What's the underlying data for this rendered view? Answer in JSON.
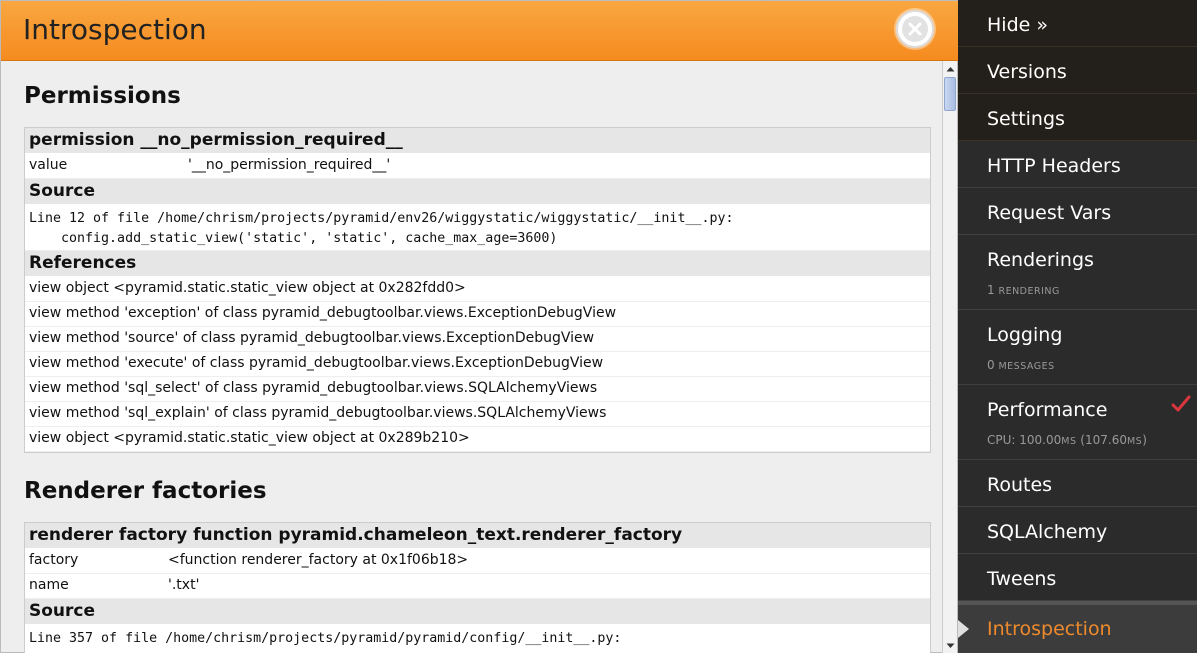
{
  "panel": {
    "title": "Introspection"
  },
  "permissions": {
    "heading": "Permissions",
    "header": "permission __no_permission_required__",
    "value_key": "value",
    "value_val": "'__no_permission_required__'",
    "source_label": "Source",
    "source_line1": "Line 12 of file /home/chrism/projects/pyramid/env26/wiggystatic/wiggystatic/__init__.py:",
    "source_line2": "    config.add_static_view('static', 'static', cache_max_age=3600)",
    "references_label": "References",
    "references": [
      "view object <pyramid.static.static_view object at 0x282fdd0>",
      "view method 'exception' of class pyramid_debugtoolbar.views.ExceptionDebugView",
      "view method 'source' of class pyramid_debugtoolbar.views.ExceptionDebugView",
      "view method 'execute' of class pyramid_debugtoolbar.views.ExceptionDebugView",
      "view method 'sql_select' of class pyramid_debugtoolbar.views.SQLAlchemyViews",
      "view method 'sql_explain' of class pyramid_debugtoolbar.views.SQLAlchemyViews",
      "view object <pyramid.static.static_view object at 0x289b210>"
    ]
  },
  "renderers": {
    "heading": "Renderer factories",
    "header": "renderer factory function pyramid.chameleon_text.renderer_factory",
    "factory_key": "factory",
    "factory_val": "<function renderer_factory at 0x1f06b18>",
    "name_key": "name",
    "name_val": "'.txt'",
    "source_label": "Source",
    "source_line1": "Line 357 of file /home/chrism/projects/pyramid/pyramid/config/__init__.py:"
  },
  "toolbar": {
    "hide": "Hide »",
    "versions": "Versions",
    "settings": "Settings",
    "http_headers": "HTTP Headers",
    "request_vars": "Request Vars",
    "renderings": "Renderings",
    "renderings_count": "1",
    "renderings_unit": "RENDERING",
    "logging": "Logging",
    "logging_count": "0",
    "logging_unit": "MESSAGES",
    "performance": "Performance",
    "perf_cpu": "CPU: 100.00",
    "perf_ms1": "MS",
    "perf_total": " (107.60",
    "perf_ms2": "MS",
    "perf_close": ")",
    "routes": "Routes",
    "sqlalchemy": "SQLAlchemy",
    "tweens": "Tweens",
    "introspection": "Introspection"
  },
  "colors": {
    "header_orange": "#f58b1f",
    "active_text": "#ee8a2c",
    "check_red": "#d9363e"
  },
  "icons": [
    "close-icon",
    "check-icon",
    "active-arrow-icon",
    "scroll-up-arrow-icon",
    "scroll-down-arrow-icon"
  ]
}
